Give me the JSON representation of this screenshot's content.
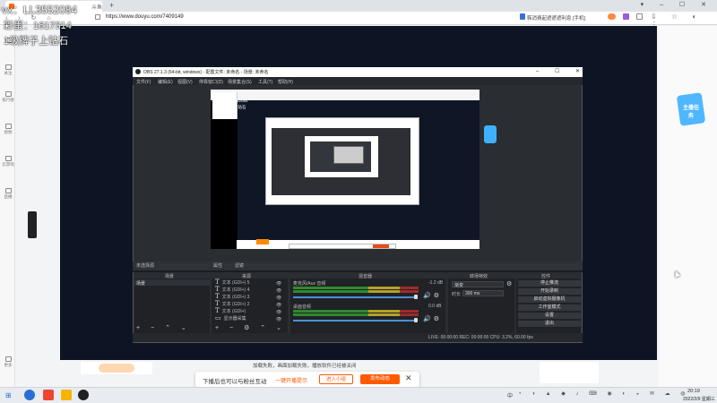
{
  "watermark": {
    "line1": "vx：LL3552084",
    "line2": "彩蛋：1617314",
    "line3": "1级牌子上钻石"
  },
  "browser": {
    "tab_title": "斗鱼",
    "url": "https://www.douyu.com/7409149",
    "toolbar_right": "韩消费起遮遮遮利息 [手机]"
  },
  "sidebar": {
    "items": [
      {
        "label": "关注"
      },
      {
        "label": "排行榜"
      },
      {
        "label": "视频"
      },
      {
        "label": "云游戏"
      },
      {
        "label": "直播"
      },
      {
        "label": "更多"
      }
    ]
  },
  "obs": {
    "title": "OBS 27.1.3 (64-bit, windows) - 配置文件: 未命名 - 场景: 未命名",
    "menu": [
      "文件(F)",
      "编辑(E)",
      "视图(V)",
      "停靠窗口(D)",
      "场景集合(S)",
      "工具(T)",
      "帮助(H)"
    ],
    "dock_headers": {
      "scenes": "场景",
      "sources": "来源",
      "mixer": "混音器",
      "transitions": "转场特效",
      "controls": "控件"
    },
    "no_source": "未选择源",
    "properties": "属性",
    "filters": "滤镜",
    "scene_item": "场景",
    "sources": [
      "文本 (GDI+) 5",
      "文本 (GDI+) 4",
      "文本 (GDI+) 3",
      "文本 (GDI+) 2",
      "文本 (GDI+)",
      "显示器采集"
    ],
    "mixer": [
      {
        "label": "麦克风/Aux 音频",
        "db": "-1.2 dB"
      },
      {
        "label": "桌面音频",
        "db": "0.0 dB"
      }
    ],
    "transition": {
      "type": "渐变",
      "duration_label": "时长",
      "duration": "300 ms"
    },
    "controls": [
      "停止推流",
      "开始录制",
      "启动虚拟摄像机",
      "工作室模式",
      "设置",
      "退出"
    ],
    "status": "LIVE: 00:00:00  REC: 00:00:00  CPU: 3.2%, 60.00 fps"
  },
  "page": {
    "notice": "加载失败，画面加载失败，播放软件已经被关闭",
    "cta_text": "下播后也可以与粉丝互动",
    "cta_link": "一键开播提示",
    "cta_btn1": "进入小组",
    "cta_btn2": "发布动态",
    "task_badge": "主播任务"
  },
  "taskbar": {
    "tray": "中",
    "time": "20:19",
    "date": "2022/2/9 星期三"
  }
}
